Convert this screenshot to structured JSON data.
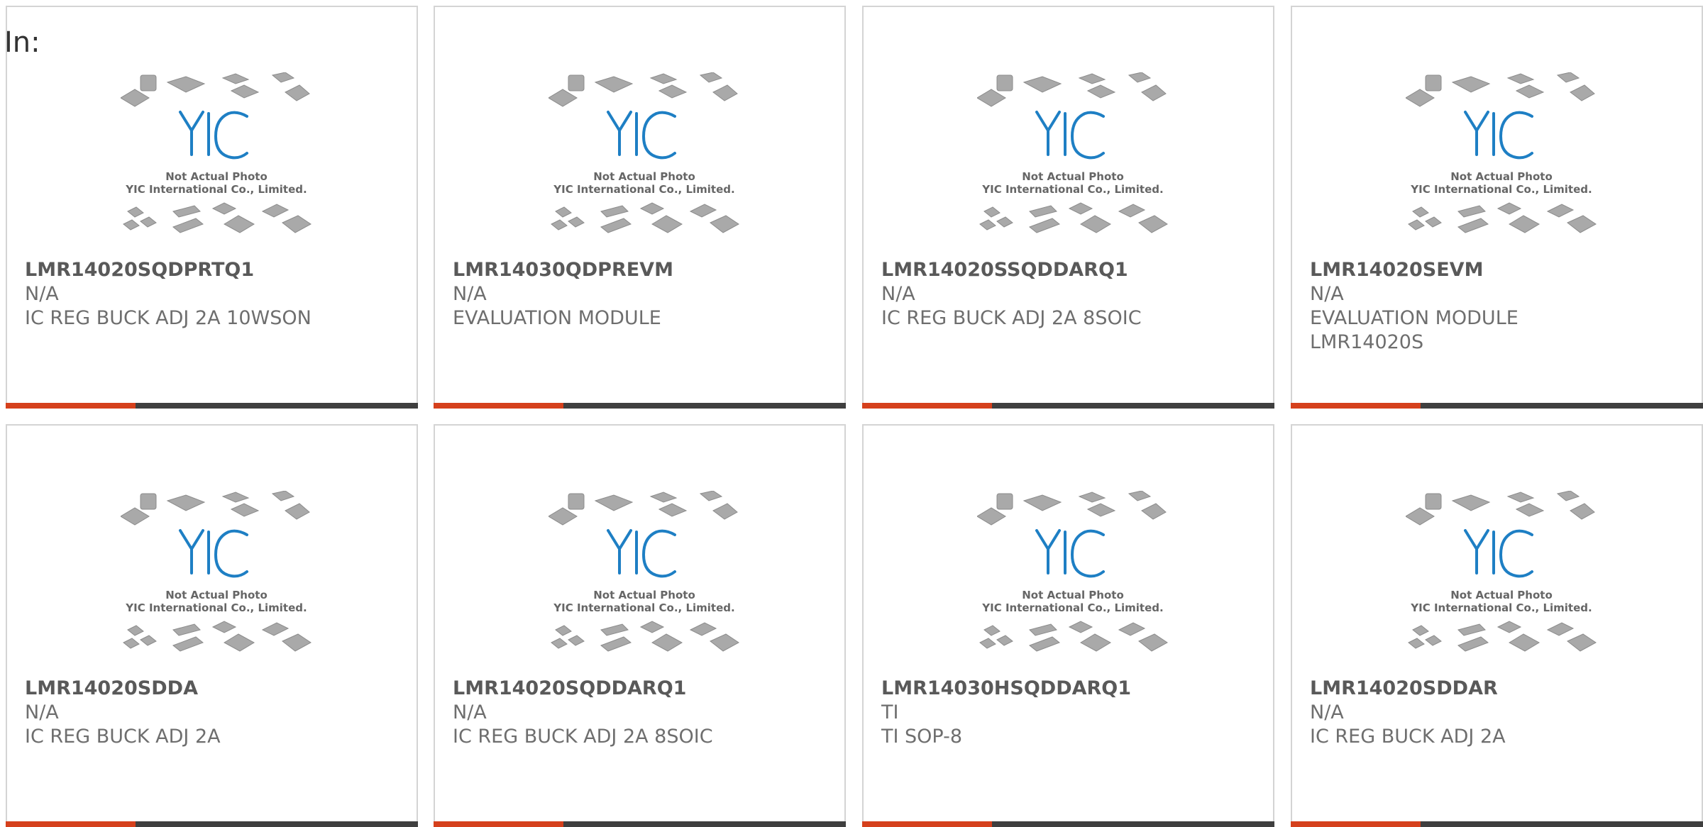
{
  "header": {
    "label": "In:"
  },
  "photo": {
    "caption_line1": "Not Actual Photo",
    "caption_line2": "YIC International Co., Limited.",
    "logo_text": "YIC"
  },
  "colors": {
    "accent": "#d5401c",
    "bar": "#3f3f3f",
    "logo": "#1e7fc4"
  },
  "products": [
    {
      "part": "LMR14020SQDPRTQ1",
      "mfr": "N/A",
      "desc": "IC REG BUCK ADJ 2A 10WSON"
    },
    {
      "part": "LMR14030QDPREVM",
      "mfr": "N/A",
      "desc": "EVALUATION MODULE"
    },
    {
      "part": "LMR14020SSQDDARQ1",
      "mfr": "N/A",
      "desc": "IC REG BUCK ADJ 2A 8SOIC"
    },
    {
      "part": "LMR14020SEVM",
      "mfr": "N/A",
      "desc": "EVALUATION MODULE LMR14020S"
    },
    {
      "part": "LMR14020SDDA",
      "mfr": "N/A",
      "desc": "IC REG BUCK ADJ 2A"
    },
    {
      "part": "LMR14020SQDDARQ1",
      "mfr": "N/A",
      "desc": "IC REG BUCK ADJ 2A 8SOIC"
    },
    {
      "part": "LMR14030HSQDDARQ1",
      "mfr": "TI",
      "desc": "TI SOP-8"
    },
    {
      "part": "LMR14020SDDAR",
      "mfr": "N/A",
      "desc": "IC REG BUCK ADJ 2A"
    }
  ]
}
